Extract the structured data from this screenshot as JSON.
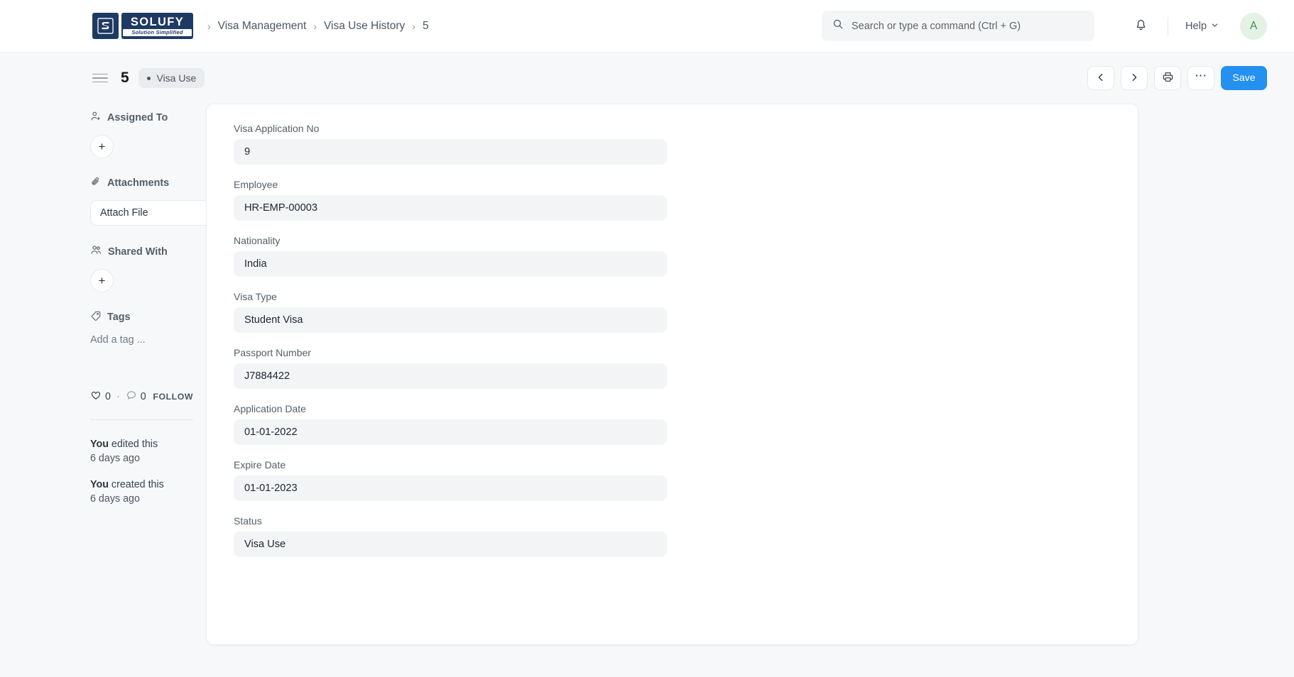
{
  "navbar": {
    "brand": {
      "mark_letter": "S",
      "name": "SOLUFY",
      "tagline": "Solution Simplified"
    },
    "breadcrumb": [
      {
        "label": "Visa Management"
      },
      {
        "label": "Visa Use History"
      },
      {
        "label": "5"
      }
    ],
    "search": {
      "placeholder": "Search or type a command (Ctrl + G)",
      "value": ""
    },
    "help_label": "Help",
    "avatar_initial": "A"
  },
  "page_head": {
    "title": "5",
    "status_badge": "Visa Use",
    "save_label": "Save"
  },
  "sidebar": {
    "assigned_to": {
      "title": "Assigned To",
      "add_label": "+"
    },
    "attachments": {
      "title": "Attachments",
      "button_label": "Attach File",
      "add_label": "+"
    },
    "shared_with": {
      "title": "Shared With",
      "add_label": "+"
    },
    "tags": {
      "title": "Tags",
      "placeholder": "Add a tag ..."
    },
    "social": {
      "like_count": "0",
      "separator": "·",
      "comment_count": "0",
      "follow_label": "FOLLOW"
    },
    "activity": [
      {
        "who": "You",
        "what": " edited this",
        "when": "6 days ago"
      },
      {
        "who": "You",
        "what": " created this",
        "when": "6 days ago"
      }
    ]
  },
  "form": {
    "fields": [
      {
        "label": "Visa Application No",
        "value": "9"
      },
      {
        "label": "Employee",
        "value": "HR-EMP-00003"
      },
      {
        "label": "Nationality",
        "value": "India"
      },
      {
        "label": "Visa Type",
        "value": "Student Visa"
      },
      {
        "label": "Passport Number",
        "value": "J7884422"
      },
      {
        "label": "Application Date",
        "value": "01-01-2022"
      },
      {
        "label": "Expire Date",
        "value": "01-01-2023"
      },
      {
        "label": "Status",
        "value": "Visa Use"
      }
    ]
  },
  "colors": {
    "brand_navy": "#1e3a63",
    "accent_blue": "#2490ef",
    "page_bg": "#f7f8f9",
    "field_bg": "#f3f4f6",
    "avatar_bg": "#e4f2e6",
    "avatar_fg": "#3f8c52"
  }
}
